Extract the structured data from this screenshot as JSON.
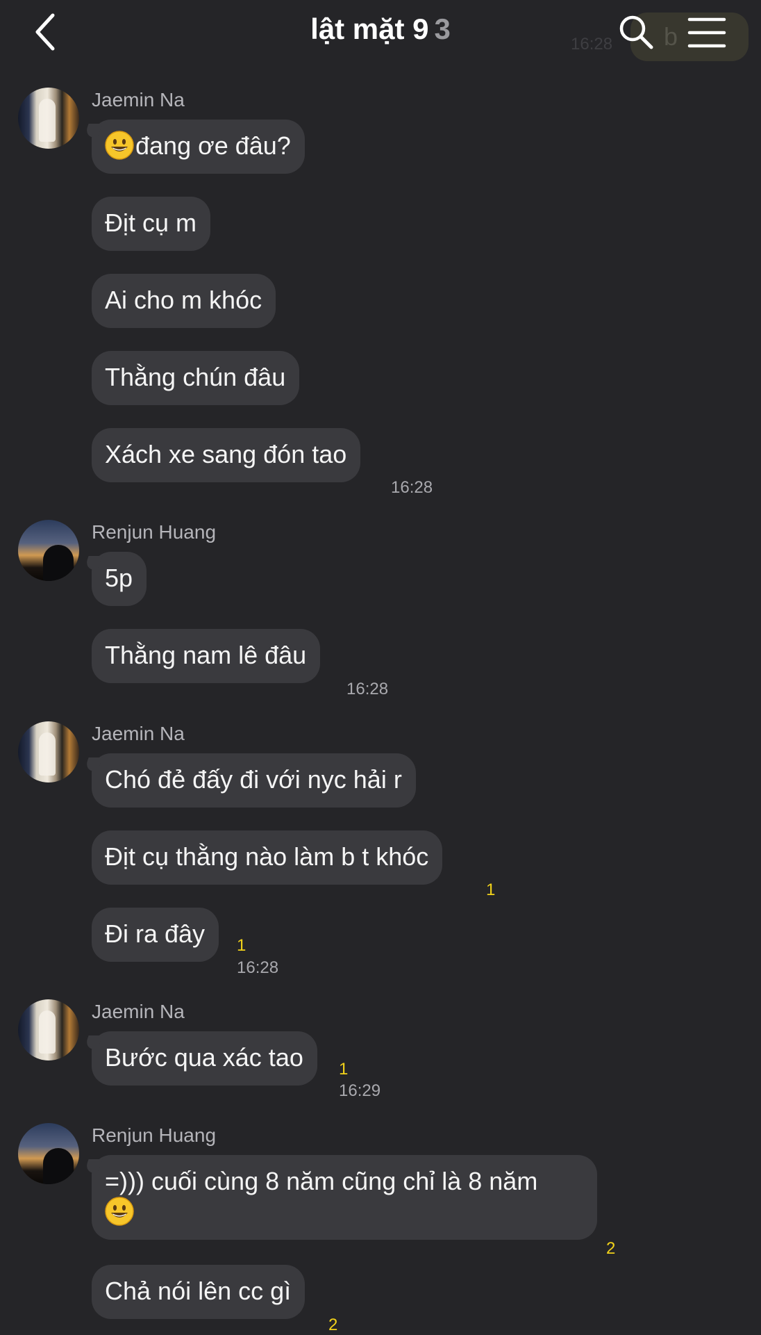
{
  "header": {
    "title": "lật mặt 9",
    "member_count": "3",
    "ghost_time": "16:28",
    "ghost_pill_text": "b"
  },
  "icons": {
    "back": "chevron-left-icon",
    "search": "search-icon",
    "menu": "hamburger-menu-icon",
    "emoji": "grinning-face-emoji"
  },
  "colors": {
    "background": "#252528",
    "bubble": "#3a3a3e",
    "unread": "#f2d21a"
  },
  "messages": {
    "group1": {
      "sender": "Jaemin Na",
      "m1": "đang ơe đâu?",
      "m2": "Địt cụ m",
      "m3": "Ai cho m khóc",
      "m4": "Thằng chún đâu",
      "m5": "Xách xe sang đón tao",
      "time": "16:28"
    },
    "group2": {
      "sender": "Renjun Huang",
      "m1": "5p",
      "m2": "Thằng nam lê đâu",
      "time": "16:28"
    },
    "group3": {
      "sender": "Jaemin Na",
      "m1": "Chó đẻ đấy đi với nyc hải r",
      "m2": "Địt cụ thằng nào làm b t khóc",
      "m2_unread": "1",
      "m3": "Đi ra đây",
      "m3_unread": "1",
      "time": "16:28"
    },
    "group4": {
      "sender": "Jaemin Na",
      "m1": "Bước qua xác tao",
      "m1_unread": "1",
      "time": "16:29"
    },
    "group5": {
      "sender": "Renjun Huang",
      "m1": "=))) cuối cùng 8 năm cũng chỉ là 8 năm",
      "m1_unread": "2",
      "m2": "Chả nói lên cc gì",
      "m2_unread": "2"
    }
  }
}
